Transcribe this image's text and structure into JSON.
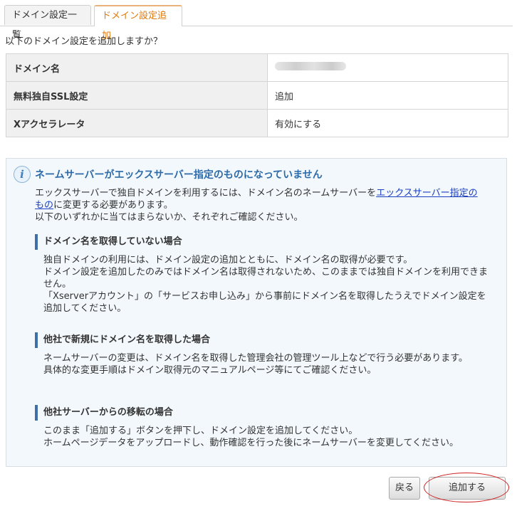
{
  "tabs": {
    "list_label": "ドメイン設定一覧",
    "add_label": "ドメイン設定追加"
  },
  "prompt": "以下のドメイン設定を追加しますか？",
  "settings": [
    {
      "key": "ドメイン名",
      "value": ""
    },
    {
      "key": "無料独自SSL設定",
      "value": "追加"
    },
    {
      "key": "Xアクセラレータ",
      "value": "有効にする"
    }
  ],
  "notice": {
    "icon": "info-icon",
    "title": "ネームサーバーがエックスサーバー指定のものになっていません",
    "intro_before_link": "エックスサーバーで独自ドメインを利用するには、ドメイン名のネームサーバーを",
    "intro_link": "エックスサーバー指定のもの",
    "intro_after_link": "に変更する必要があります。",
    "intro_line2": "以下のいずれかに当てはまらないか、それぞれご確認ください。",
    "sections": [
      {
        "heading": "ドメイン名を取得していない場合",
        "lines": [
          "独自ドメインの利用には、ドメイン設定の追加とともに、ドメイン名の取得が必要です。",
          "ドメイン設定を追加したのみではドメイン名は取得されないため、このままでは独自ドメインを利用できません。",
          "「Xserverアカウント」の「サービスお申し込み」から事前にドメイン名を取得したうえでドメイン設定を追加してください。"
        ]
      },
      {
        "heading": "他社で新規にドメイン名を取得した場合",
        "lines": [
          "ネームサーバーの変更は、ドメイン名を取得した管理会社の管理ツール上などで行う必要があります。",
          "具体的な変更手順はドメイン取得元のマニュアルページ等にてご確認ください。"
        ]
      },
      {
        "heading": "他社サーバーからの移転の場合",
        "lines": [
          "このまま「追加する」ボタンを押下し、ドメイン設定を追加してください。",
          "ホームページデータをアップロードし、動作確認を行った後にネームサーバーを変更してください。"
        ]
      }
    ]
  },
  "buttons": {
    "back": "戻る",
    "add": "追加する"
  },
  "colors": {
    "accent_tab": "#e07a10",
    "notice_title": "#2c6aa8",
    "highlight_ring": "#d02020"
  }
}
